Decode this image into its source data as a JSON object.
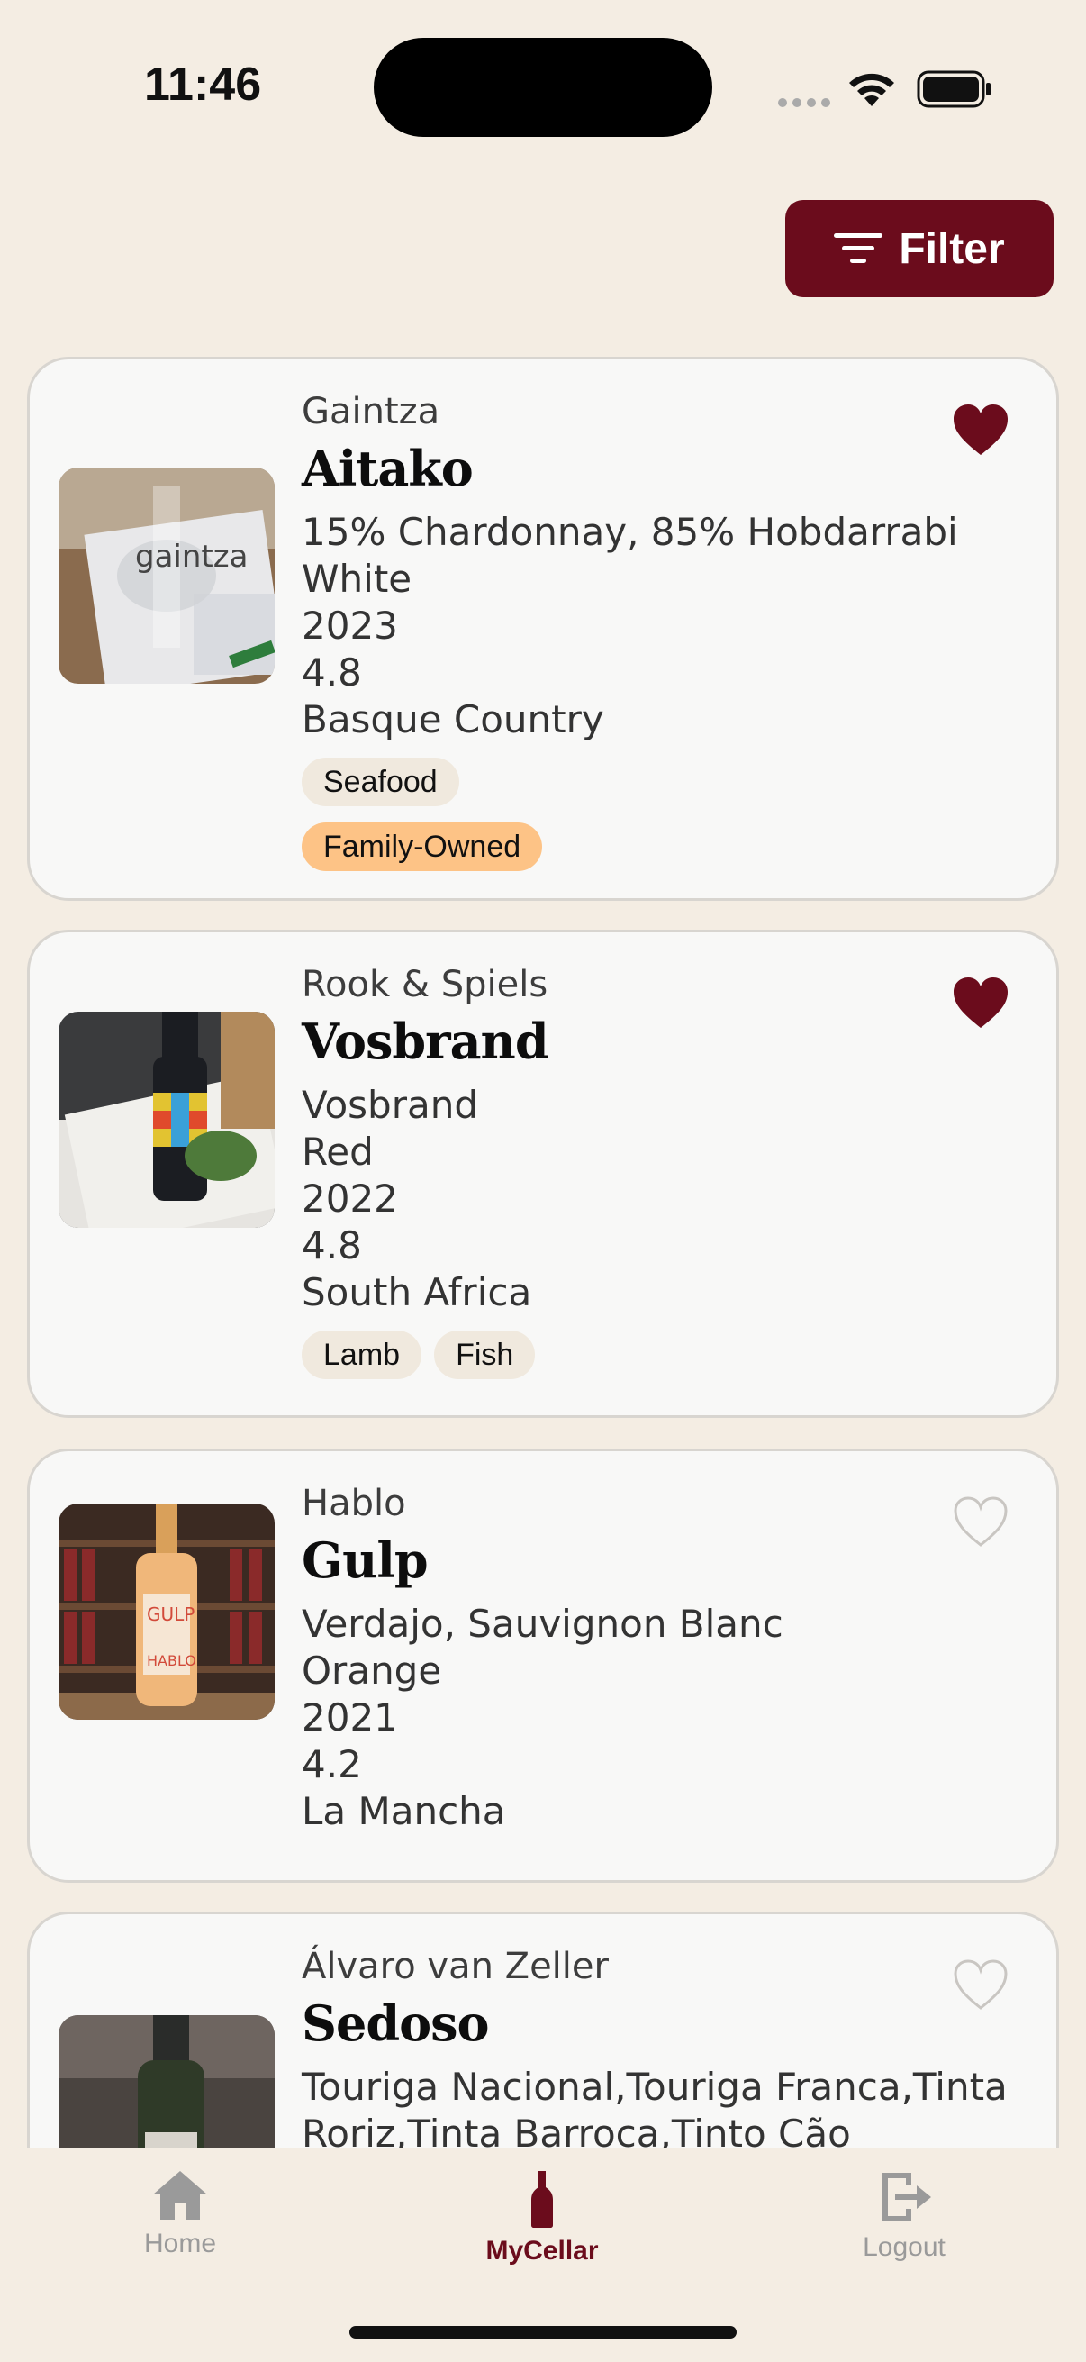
{
  "status": {
    "time": "11:46"
  },
  "filter": {
    "label": "Filter"
  },
  "wines": [
    {
      "producer": "Gaintza",
      "name": "Aitako",
      "grapes": "15% Chardonnay, 85% Hobdarrabi",
      "color": "White",
      "vintage": "2023",
      "rating": "4.8",
      "region": "Basque Country",
      "pairings": [
        "Seafood"
      ],
      "badges": [
        "Family-Owned"
      ],
      "favorite": true
    },
    {
      "producer": "Rook & Spiels",
      "name": "Vosbrand",
      "grapes": "Vosbrand",
      "color": "Red",
      "vintage": "2022",
      "rating": "4.8",
      "region": "South Africa",
      "pairings": [
        "Lamb",
        "Fish"
      ],
      "favorite": true
    },
    {
      "producer": "Hablo",
      "name": "Gulp",
      "grapes": "Verdajo, Sauvignon Blanc",
      "color": "Orange",
      "vintage": "2021",
      "rating": "4.2",
      "region": "La Mancha",
      "favorite": false
    },
    {
      "producer": " Álvaro van Zeller",
      "name": "Sedoso",
      "grapes_line1": "Touriga Nacional,Touriga Franca,Tinta",
      "grapes_line2": "Roriz,Tinta Barroca,Tinto Cão",
      "favorite": false
    }
  ],
  "tabs": [
    {
      "label": "Home",
      "icon": "house-icon"
    },
    {
      "label": "MyCellar",
      "icon": "wine-bottle-icon",
      "active": true
    },
    {
      "label": "Logout",
      "icon": "logout-icon"
    }
  ],
  "colors": {
    "accent": "#6b0c1c",
    "background": "#f4ede3",
    "card": "#f8f8f7",
    "badge_orange": "#fdc386",
    "chip": "#f0e9de"
  }
}
